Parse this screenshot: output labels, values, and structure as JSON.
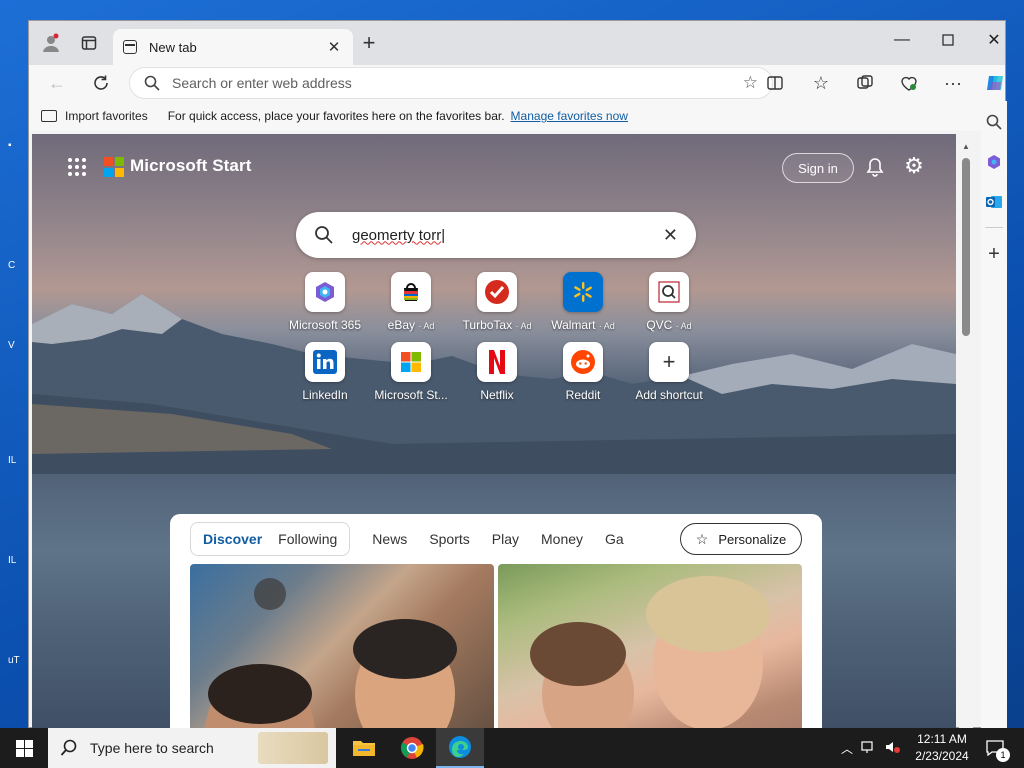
{
  "browser": {
    "tab": {
      "title": "New tab"
    },
    "address_bar": {
      "placeholder": "Search or enter web address"
    },
    "favorites_bar": {
      "import_label": "Import favorites",
      "message": "For quick access, place your favorites here on the favorites bar.",
      "manage_link": "Manage favorites now"
    }
  },
  "start_page": {
    "brand": "Microsoft Start",
    "sign_in_label": "Sign in",
    "search": {
      "query": "geomerty torr"
    },
    "shortcuts": [
      {
        "label": "Microsoft 365",
        "ad": ""
      },
      {
        "label": "eBay",
        "ad": "· Ad"
      },
      {
        "label": "TurboTax",
        "ad": "· Ad"
      },
      {
        "label": "Walmart",
        "ad": "· Ad"
      },
      {
        "label": "QVC",
        "ad": "· Ad"
      },
      {
        "label": "LinkedIn",
        "ad": ""
      },
      {
        "label": "Microsoft St...",
        "ad": ""
      },
      {
        "label": "Netflix",
        "ad": ""
      },
      {
        "label": "Reddit",
        "ad": ""
      },
      {
        "label": "Add shortcut",
        "ad": ""
      }
    ],
    "feed": {
      "tabs": [
        "Discover",
        "Following",
        "News",
        "Sports",
        "Play",
        "Money",
        "Ga"
      ],
      "active_tab": "Discover",
      "personalize_label": "Personalize"
    }
  },
  "taskbar": {
    "search_placeholder": "Type here to search",
    "time": "12:11 AM",
    "date": "2/23/2024",
    "notification_count": "1"
  },
  "colors": {
    "accent": "#115ea3",
    "ms_red": "#f25022",
    "ms_green": "#7fba00",
    "ms_blue": "#00a4ef",
    "ms_yellow": "#ffb900"
  }
}
